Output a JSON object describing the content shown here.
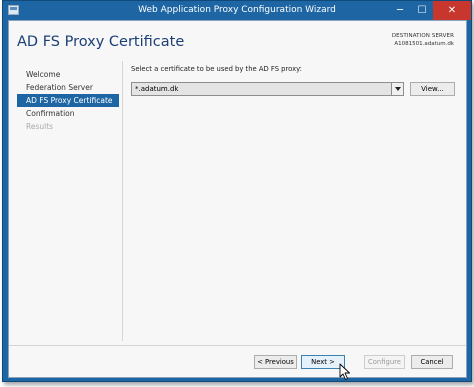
{
  "window": {
    "title": "Web Application Proxy Configuration Wizard",
    "controls": {
      "minimize": "─",
      "maximize": "☐",
      "close": "✕"
    }
  },
  "header": {
    "page_title": "AD FS Proxy Certificate",
    "destination_label": "DESTINATION SERVER",
    "destination_value": "A1081501.adatum.dk"
  },
  "nav": {
    "items": [
      {
        "label": "Welcome",
        "state": "normal"
      },
      {
        "label": "Federation Server",
        "state": "normal"
      },
      {
        "label": "AD FS Proxy Certificate",
        "state": "active"
      },
      {
        "label": "Confirmation",
        "state": "normal"
      },
      {
        "label": "Results",
        "state": "disabled"
      }
    ]
  },
  "content": {
    "instruction": "Select a certificate to be used by the AD FS proxy:",
    "certificate_value": "*.adatum.dk",
    "view_button": "View..."
  },
  "footer": {
    "previous": "< Previous",
    "next": "Next >",
    "configure": "Configure",
    "cancel": "Cancel"
  },
  "colors": {
    "title_bar": "#1e66a3",
    "close_button": "#c7372d",
    "active_nav": "#1e66a3",
    "page_title": "#1c3f77"
  }
}
